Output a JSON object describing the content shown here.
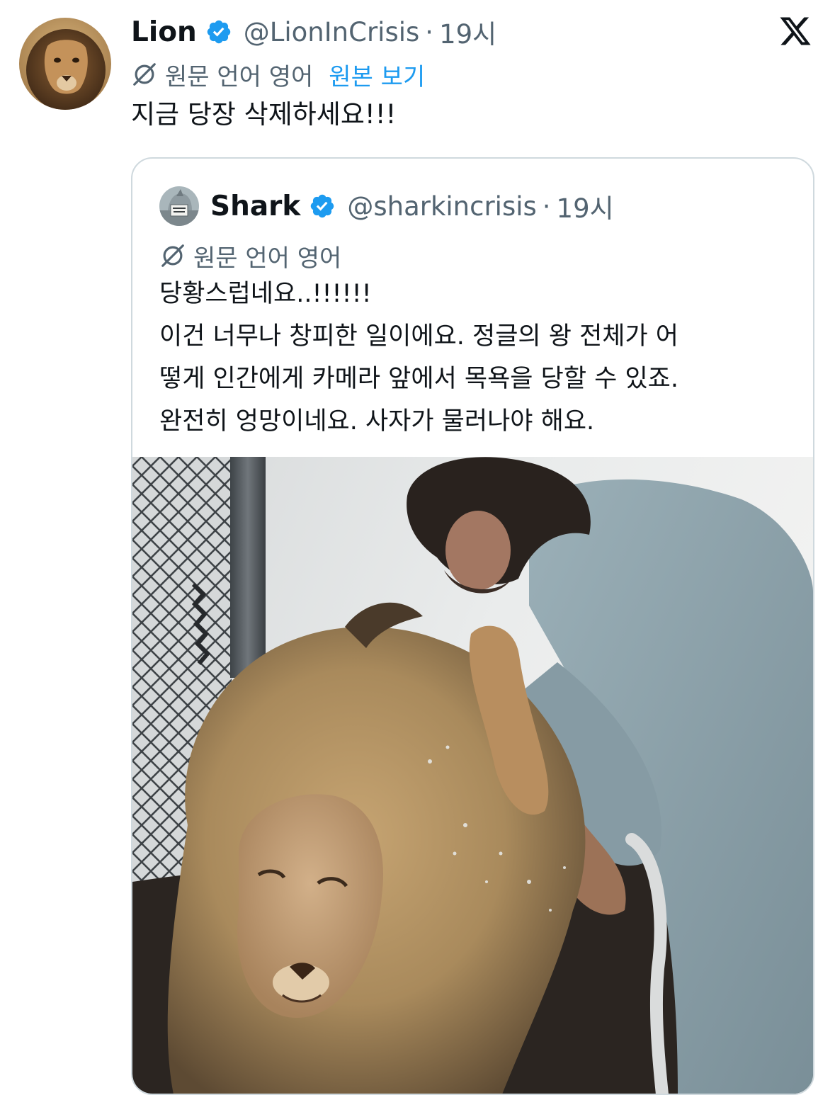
{
  "tweet": {
    "author": {
      "name": "Lion",
      "handle": "@LionInCrisis",
      "time": "19시",
      "verified": true
    },
    "translation": {
      "label": "원문 언어 영어",
      "action": "원본 보기"
    },
    "text": "지금 당장 삭제하세요!!!"
  },
  "quote": {
    "author": {
      "name": "Shark",
      "handle": "@sharkincrisis",
      "time": "19시",
      "verified": true
    },
    "translation": {
      "label": "원문 언어 영어"
    },
    "lines": [
      "당황스럽네요..!!!!!!",
      "이건 너무나 창피한 일이에요. 정글의 왕 전체가 어",
      "떻게 인간에게 카메라 앞에서 목욕을 당할 수 있죠.",
      "완전히 엉망이네요. 사자가 물러나야 해요."
    ]
  },
  "separator": "·",
  "icons": {
    "verified": "verified-badge-icon",
    "translate": "translate-icon",
    "brand": "x-logo-icon"
  },
  "colors": {
    "text": "#0f1419",
    "secondary": "#536471",
    "link": "#1d9bf0",
    "verified": "#1d9bf0",
    "border": "#cfd9de"
  }
}
